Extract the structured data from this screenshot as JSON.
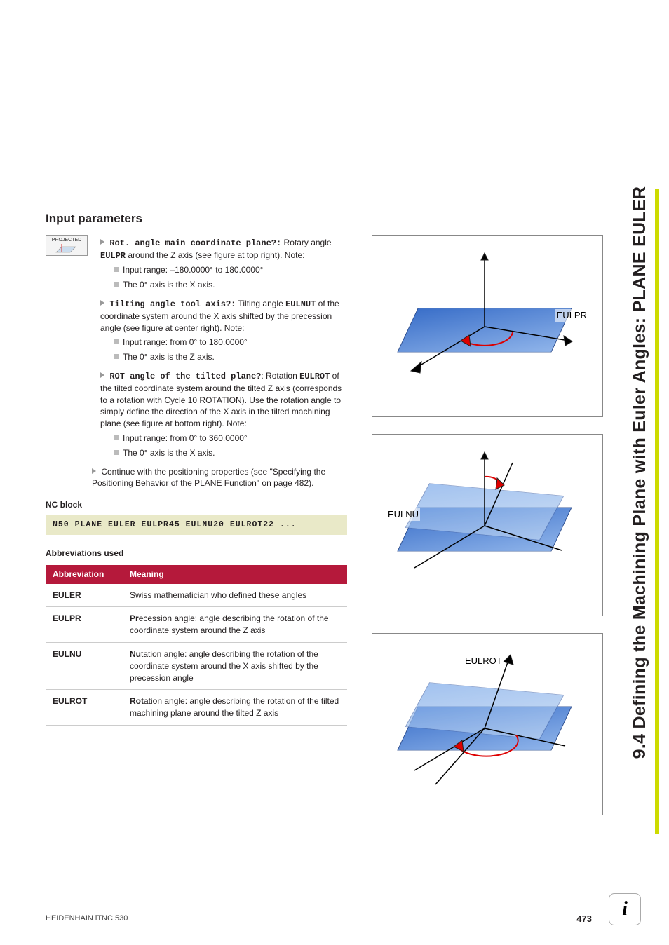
{
  "side_title": "9.4 Defining the Machining Plane with Euler Angles: PLANE EULER",
  "heading": "Input parameters",
  "icon_button_label": "PROJECTED",
  "params": [
    {
      "lead_mono": "Rot. angle main coordinate plane?:",
      "lead_rest": " Rotary angle ",
      "bold2": "EULPR",
      "rest2": " around the Z axis (see figure at top right). Note:",
      "bullets": [
        "Input range: –180.0000° to 180.0000°",
        "The 0° axis is the X axis."
      ]
    },
    {
      "lead_mono": "Tilting angle tool axis?:",
      "lead_rest": " Tilting angle ",
      "bold2": "EULNUT",
      "rest2": " of the coordinate system around the X axis shifted by the precession angle (see figure at center right). Note:",
      "bullets": [
        "Input range: from 0° to 180.0000°",
        "The 0° axis is the Z axis."
      ]
    },
    {
      "lead_mono": "ROT angle of the tilted plane?",
      "lead_rest": ": Rotation ",
      "bold2": "EULROT",
      "rest2": " of the tilted coordinate system around the tilted Z axis (corresponds to a rotation with Cycle 10 ROTATION). Use the rotation angle to simply define the direction of the X axis in the tilted machining plane (see figure at bottom right). Note:",
      "bullets": [
        "Input range: from 0° to 360.0000°",
        "The 0° axis is the X axis."
      ]
    }
  ],
  "continue_text": "Continue with the positioning properties (see \"Specifying the Positioning Behavior of the PLANE Function\" on page 482).",
  "nc_heading": "NC block",
  "nc_code": "N50 PLANE EULER EULPR45 EULNU20 EULROT22 ...",
  "abbr_heading": "Abbreviations used",
  "table": {
    "headers": [
      "Abbreviation",
      "Meaning"
    ],
    "rows": [
      {
        "abbr": "EULER",
        "meaning_bold": "",
        "meaning_rest": "Swiss mathematician who defined these angles"
      },
      {
        "abbr": "EULPR",
        "meaning_bold": "Pr",
        "meaning_rest": "ecession angle: angle describing the rotation of the coordinate system around the Z axis"
      },
      {
        "abbr": "EULNU",
        "meaning_bold": "Nu",
        "meaning_rest": "tation angle: angle describing the rotation of the coordinate system around the X axis shifted by the precession angle"
      },
      {
        "abbr": "EULROT",
        "meaning_bold": "Rot",
        "meaning_rest": "ation angle: angle describing the rotation of the tilted machining plane around the tilted Z axis"
      }
    ]
  },
  "figures": [
    {
      "label": "EULPR"
    },
    {
      "label": "EULNU"
    },
    {
      "label": "EULROT"
    }
  ],
  "footer_left": "HEIDENHAIN iTNC 530",
  "footer_page": "473"
}
